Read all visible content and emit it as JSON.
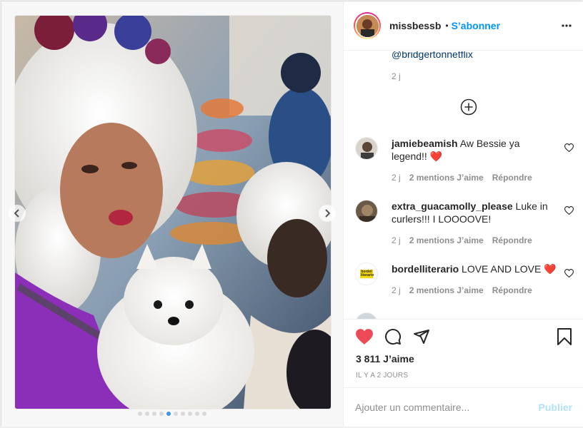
{
  "post": {
    "username": "missbessb",
    "separator": "•",
    "follow_label": "S’abonner",
    "caption_tail": "@bridgertonnetflix",
    "caption_time": "2 j"
  },
  "comments": [
    {
      "username": "jamiebeamish",
      "text": "Aw Bessie ya legend!!",
      "emoji": "❤️",
      "time": "2 j",
      "likes": "2 mentions J’aime",
      "reply": "Répondre"
    },
    {
      "username": "extra_guacamolly_please",
      "text": "Luke in curlers!!! I LOOOOVE!",
      "emoji": "",
      "time": "2 j",
      "likes": "2 mentions J’aime",
      "reply": "Répondre"
    },
    {
      "username": "bordelliterario",
      "text": "LOVE AND LOVE",
      "emoji": "❤️",
      "time": "2 j",
      "likes": "2 mentions J’aime",
      "reply": "Répondre",
      "avatar_text": "bordel literario"
    }
  ],
  "actions": {
    "likes_count": "3 811 J’aime",
    "time_ago": "IL Y A 2 JOURS"
  },
  "add_comment": {
    "placeholder": "Ajouter un commentaire...",
    "publish_label": "Publier"
  },
  "carousel": {
    "total": 10,
    "active_index": 4
  },
  "colors": {
    "accent": "#0095f6",
    "like_red": "#ed4956",
    "publish_disabled": "#b2dffc"
  },
  "icons": [
    "more-icon",
    "plus-circle-icon",
    "heart-icon",
    "comment-icon",
    "share-icon",
    "bookmark-icon",
    "chevron-left-icon",
    "chevron-right-icon"
  ]
}
